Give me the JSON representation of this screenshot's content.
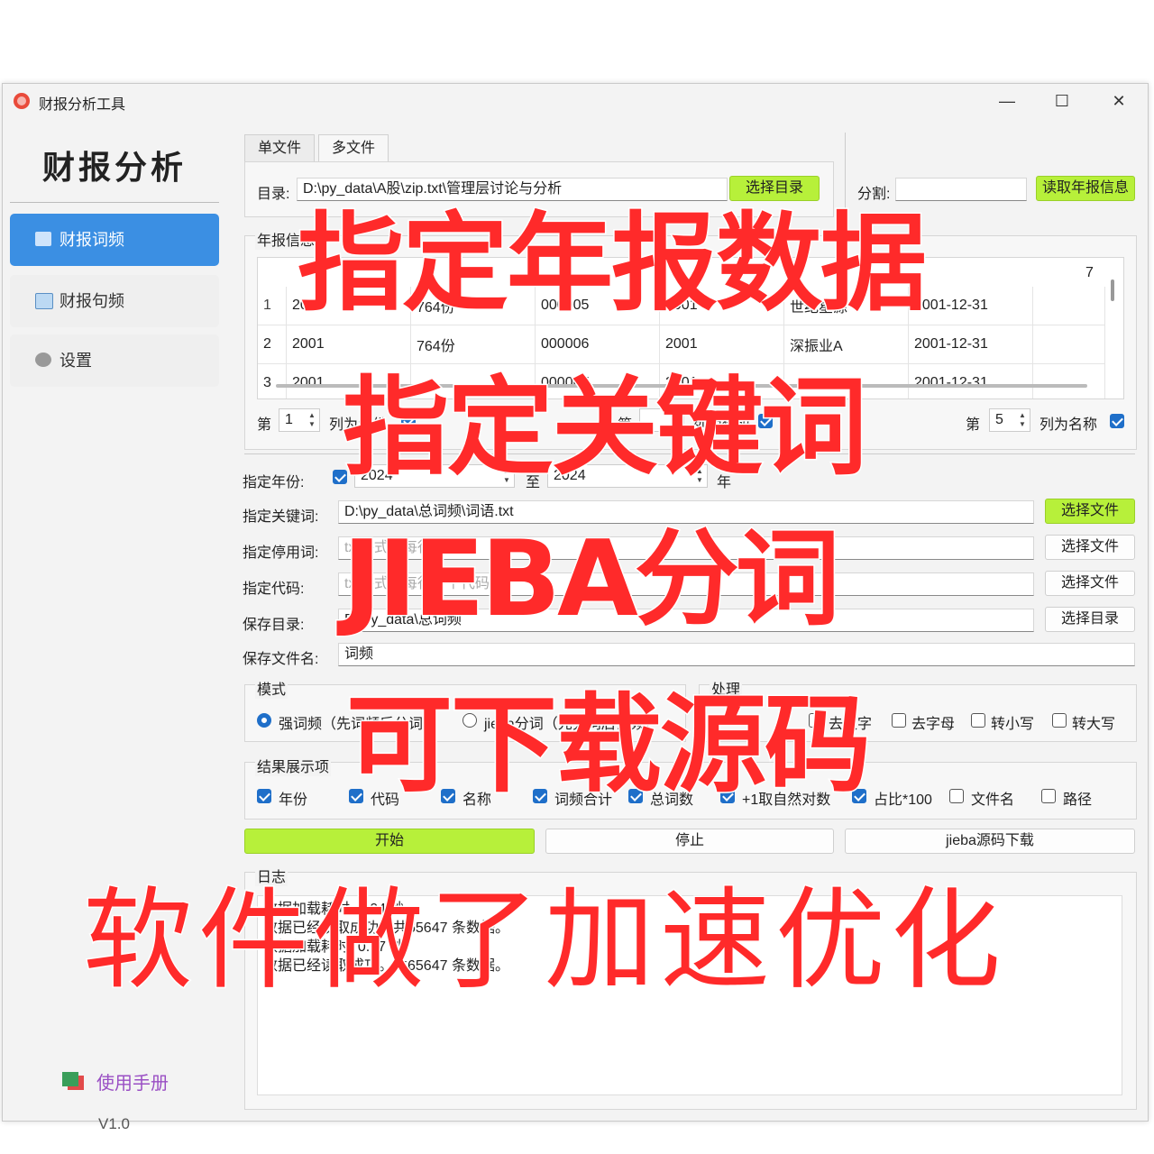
{
  "window": {
    "title": "财报分析工具",
    "controls": [
      "—",
      "☐",
      "✕"
    ]
  },
  "sidebar": {
    "title": "财报分析",
    "items": [
      {
        "label": "财报词频",
        "icon": "chart-icon",
        "active": true
      },
      {
        "label": "财报句频",
        "icon": "book-icon",
        "active": false
      },
      {
        "label": "设置",
        "icon": "gear-icon",
        "active": false
      }
    ],
    "manual": "使用手册",
    "version": "V1.0"
  },
  "tabs": [
    "单文件",
    "多文件"
  ],
  "dir_row": {
    "label": "目录:",
    "value": "D:\\py_data\\A股\\zip.txt\\管理层讨论与分析",
    "button": "选择目录"
  },
  "split_row": {
    "label": "分割:",
    "button": "读取年报信息"
  },
  "annual_group": {
    "title": "年报信息"
  },
  "table": {
    "header_tail": "7",
    "rows": [
      {
        "idx": "1",
        "c1": "2001",
        "c2": "764份",
        "c3": "000005",
        "c4": "2001",
        "c5": "世纪星源",
        "c6": "2001-12-31"
      },
      {
        "idx": "2",
        "c1": "2001",
        "c2": "764份",
        "c3": "000006",
        "c4": "2001",
        "c5": "深振业A",
        "c6": "2001-12-31"
      },
      {
        "idx": "3",
        "c1": "2001",
        "c2": "",
        "c3": "000007",
        "c4": "2001",
        "c5": "",
        "c6": "2001-12-31"
      }
    ]
  },
  "col_selectors": [
    {
      "pre": "第",
      "value": "1",
      "post": "列为年份"
    },
    {
      "pre": "第",
      "value": "",
      "post": "列为代码"
    },
    {
      "pre": "第",
      "value": "5",
      "post": "列为名称"
    }
  ],
  "form": {
    "year_label": "指定年份:",
    "year_from": "2024",
    "year_to_label": "至",
    "year_to": "2024",
    "year_suffix": "年",
    "keyword_label": "指定关键词:",
    "keyword_value": "D:\\py_data\\总词频\\词语.txt",
    "keyword_button": "选择文件",
    "stop_label": "指定停用词:",
    "stop_placeholder": "txt格式，每行一个词",
    "stop_button": "选择文件",
    "code_label": "指定代码:",
    "code_placeholder": "txt格式，每行一个代码",
    "code_button": "选择文件",
    "save_dir_label": "保存目录:",
    "save_dir_value": "D:\\py_data\\总词频",
    "save_dir_button": "选择目录",
    "save_name_label": "保存文件名:",
    "save_name_value": "词频"
  },
  "mode": {
    "title": "模式",
    "opt1": "强词频（先词频后分词）",
    "opt2": "jieba分词（先分词后词频）"
  },
  "process": {
    "title": "处理",
    "opt1": "去数字",
    "opt2": "去字母",
    "opt3": "转小写",
    "opt4": "转大写"
  },
  "result": {
    "title": "结果展示项",
    "items": [
      {
        "label": "年份",
        "checked": true
      },
      {
        "label": "代码",
        "checked": true
      },
      {
        "label": "名称",
        "checked": true
      },
      {
        "label": "词频合计",
        "checked": true
      },
      {
        "label": "总词数",
        "checked": true
      },
      {
        "label": "+1取自然对数",
        "checked": true
      },
      {
        "label": "占比*100",
        "checked": true
      },
      {
        "label": "文件名",
        "checked": false
      },
      {
        "label": "路径",
        "checked": false
      }
    ]
  },
  "actions": {
    "start": "开始",
    "stop": "停止",
    "download": "jieba源码下载"
  },
  "log": {
    "title": "日志",
    "lines": [
      "数据加载耗时: 1.04 秒",
      "数据已经读取成功。共65647 条数据。",
      "数据加载耗时: 0.97 秒",
      "数据已经读取成功。共65647 条数据。"
    ]
  },
  "overlay": {
    "line1": "指定年报数据",
    "line2": "指定关键词",
    "line3": "JIEBA分词",
    "line4": "可下载源码",
    "line5": "软件做了加速优化",
    "color": "#ff2a2a"
  }
}
